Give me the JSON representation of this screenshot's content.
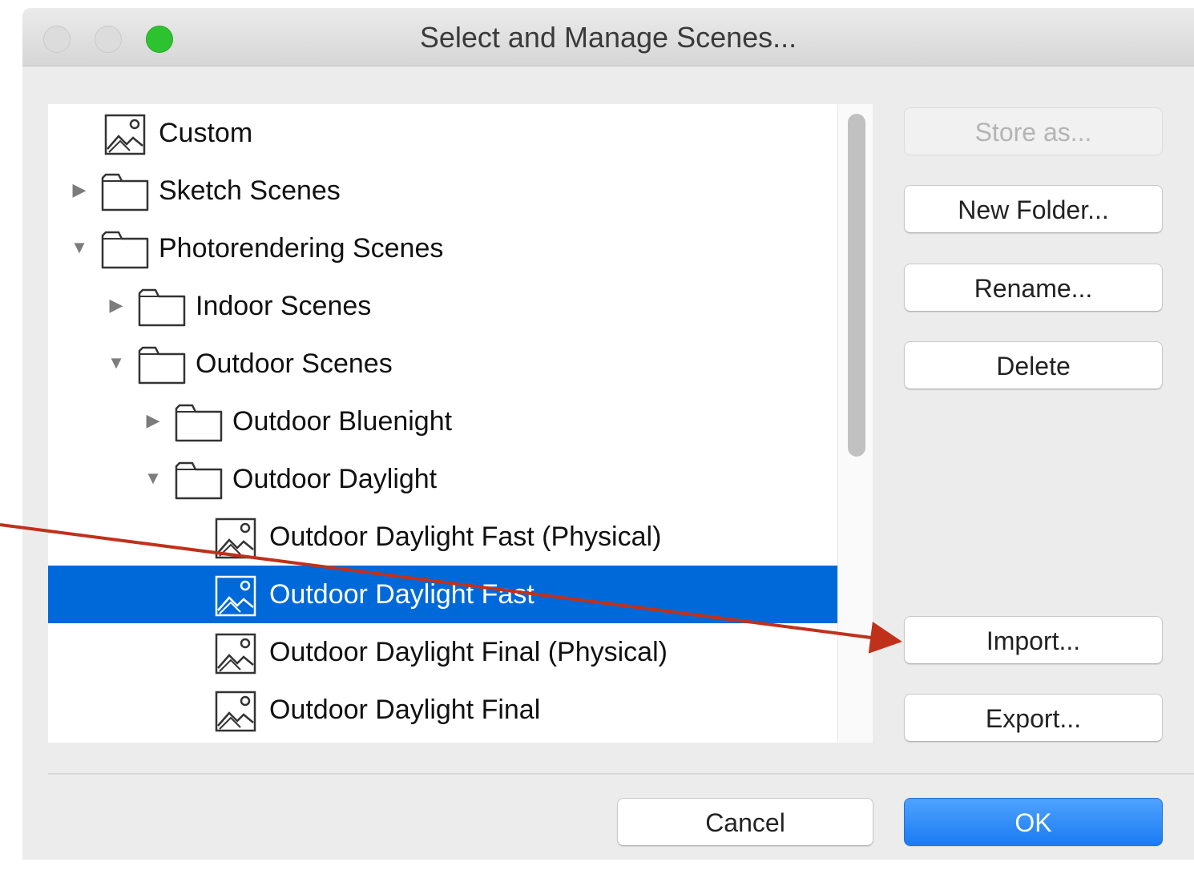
{
  "window": {
    "title": "Select and Manage Scenes..."
  },
  "tree": {
    "items": [
      {
        "label": "Custom",
        "kind": "scene",
        "level": 0,
        "expander": "none",
        "selected": false
      },
      {
        "label": "Sketch Scenes",
        "kind": "folder",
        "level": 0,
        "expander": "collapsed",
        "selected": false
      },
      {
        "label": "Photorendering Scenes",
        "kind": "folder",
        "level": 0,
        "expander": "expanded",
        "selected": false
      },
      {
        "label": "Indoor Scenes",
        "kind": "folder",
        "level": 1,
        "expander": "collapsed",
        "selected": false
      },
      {
        "label": "Outdoor Scenes",
        "kind": "folder",
        "level": 1,
        "expander": "expanded",
        "selected": false
      },
      {
        "label": "Outdoor Bluenight",
        "kind": "folder",
        "level": 2,
        "expander": "collapsed",
        "selected": false
      },
      {
        "label": "Outdoor Daylight",
        "kind": "folder",
        "level": 2,
        "expander": "expanded",
        "selected": false
      },
      {
        "label": "Outdoor Daylight Fast (Physical)",
        "kind": "scene",
        "level": 3,
        "expander": "none",
        "selected": false
      },
      {
        "label": "Outdoor Daylight Fast",
        "kind": "scene",
        "level": 3,
        "expander": "none",
        "selected": true
      },
      {
        "label": "Outdoor Daylight Final (Physical)",
        "kind": "scene",
        "level": 3,
        "expander": "none",
        "selected": false
      },
      {
        "label": "Outdoor Daylight Final",
        "kind": "scene",
        "level": 3,
        "expander": "none",
        "selected": false
      }
    ]
  },
  "buttons": {
    "store_as": "Store as...",
    "new_folder": "New Folder...",
    "rename": "Rename...",
    "delete": "Delete",
    "import": "Import...",
    "export": "Export...",
    "cancel": "Cancel",
    "ok": "OK"
  },
  "colors": {
    "selection": "#0069d9",
    "ok_button": "#1a7bf2",
    "annotation_arrow": "#c0311b",
    "zoom_light": "#2dc22f"
  },
  "icons": {
    "scene": "landscape-image-icon",
    "folder": "folder-icon",
    "expanded": "triangle-down-icon",
    "collapsed": "triangle-right-icon"
  }
}
